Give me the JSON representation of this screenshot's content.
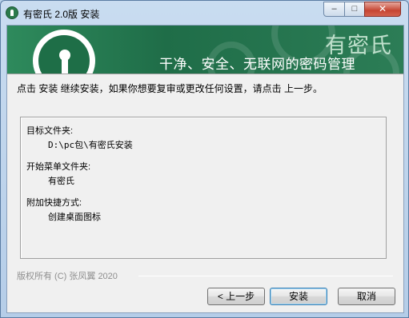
{
  "window": {
    "title": "有密氏 2.0版 安装",
    "controls": {
      "minimize": "–",
      "maximize": "□",
      "close": "✕"
    }
  },
  "banner": {
    "brand_name": "有密氏",
    "slogan": "干净、安全、无联网的密码管理",
    "colors": {
      "background": "#1e6e47",
      "logo": "#ffffff"
    }
  },
  "instruction": "点击 安装 继续安装，如果你想要复审或更改任何设置，请点击 上一步。",
  "summary": {
    "destination_label": "目标文件夹:",
    "destination_value": "D:\\pc包\\有密氏安装",
    "start_menu_label": "开始菜单文件夹:",
    "start_menu_value": "有密氏",
    "tasks_label": "附加快捷方式:",
    "tasks_value": "创建桌面图标"
  },
  "footer": {
    "copyright": "版权所有 (C) 张凤翼 2020"
  },
  "buttons": {
    "back": "< 上一步",
    "install": "安装",
    "cancel": "取消"
  }
}
